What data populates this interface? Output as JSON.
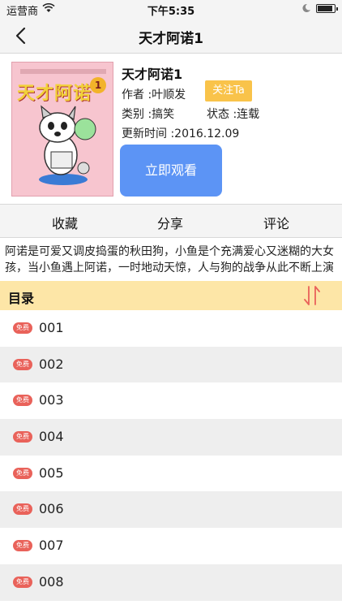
{
  "status_bar": {
    "carrier": "运营商",
    "time": "下午5:35",
    "battery_level": 0.9
  },
  "nav": {
    "title": "天才阿诺1"
  },
  "book": {
    "cover_title": "天才阿诺",
    "cover_badge": "1",
    "title": "天才阿诺1",
    "author": "作者 :叶顺发",
    "follow_label": "关注Ta",
    "category": "类别 :搞笑",
    "status": "状态 :连载",
    "updated": "更新时间 :2016.12.09",
    "watch_label": "立即观看"
  },
  "actions": {
    "collect": "收藏",
    "share": "分享",
    "comment": "评论"
  },
  "description": "阿诺是可爱又调皮捣蛋的秋田狗，小鱼是个充满爱心又迷糊的大女孩，当小鱼遇上阿诺，一时地动天惊，人与狗的战争从此不断上演",
  "catalog": {
    "title": "目录",
    "free_tag": "免费",
    "chapters": [
      "001",
      "002",
      "003",
      "004",
      "005",
      "006",
      "007",
      "008"
    ]
  },
  "colors": {
    "accent": "#5c94f5",
    "follow": "#f9c34a",
    "catalog_header": "#fde6a7",
    "free_tag": "#e9625a"
  }
}
